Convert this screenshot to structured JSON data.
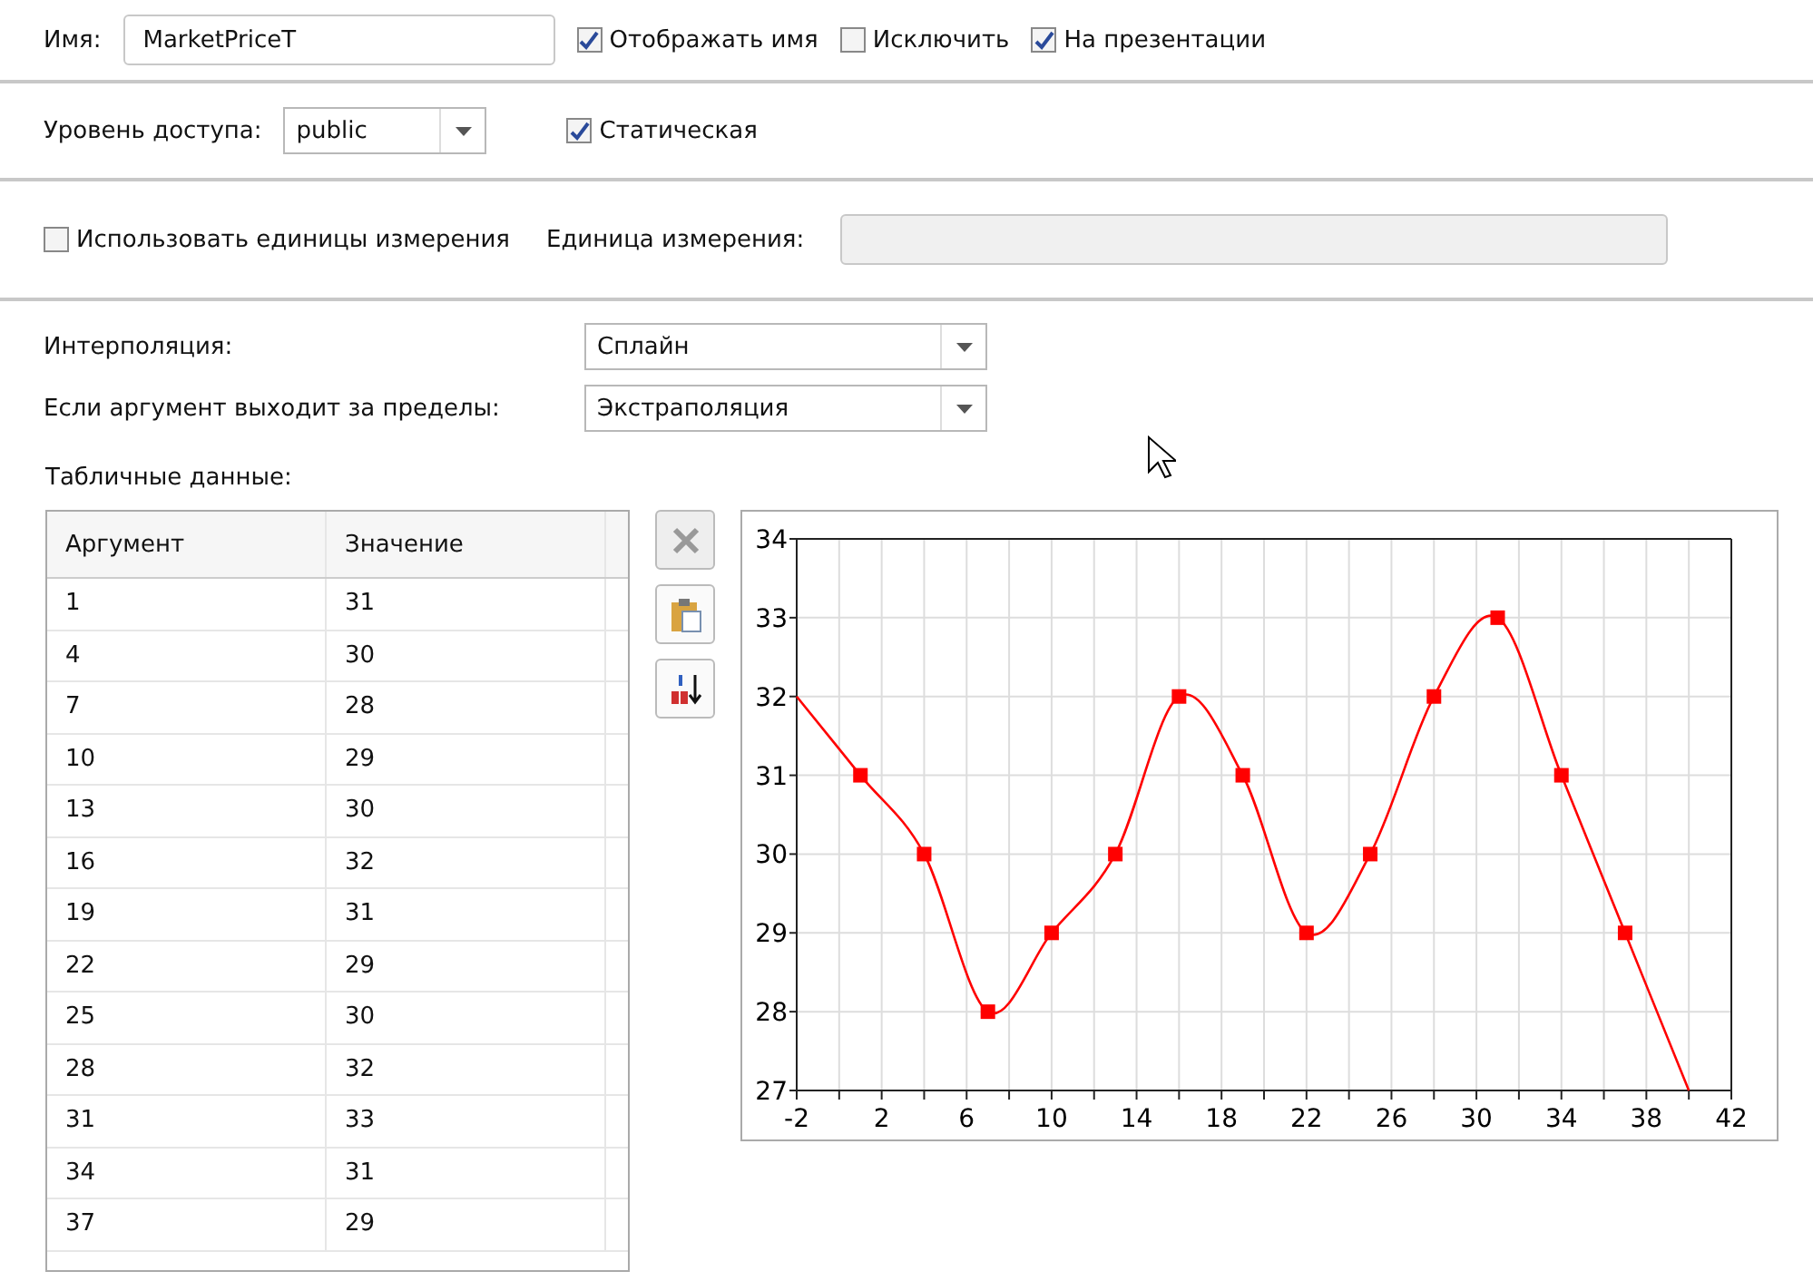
{
  "name_row": {
    "label": "Имя:",
    "value": "MarketPriceT",
    "checkboxes": [
      {
        "label": "Отображать имя",
        "checked": true
      },
      {
        "label": "Исключить",
        "checked": false
      },
      {
        "label": "На презентации",
        "checked": true
      }
    ]
  },
  "access_row": {
    "label": "Уровень доступа:",
    "value": "public",
    "checkbox": {
      "label": "Статическая",
      "checked": true
    }
  },
  "units_row": {
    "checkbox": {
      "label": "Использовать единицы измерения",
      "checked": false
    },
    "unit_label": "Единица измерения:",
    "unit_disabled": true
  },
  "interpolation": {
    "label": "Интерполяция:",
    "value": "Сплайн"
  },
  "out_of_range": {
    "label": "Если аргумент выходит за пределы:",
    "value": "Экстраполяция"
  },
  "table_label": "Табличные данные:",
  "table": {
    "columns": [
      "Аргумент",
      "Значение"
    ],
    "rows": [
      [
        "1",
        "31"
      ],
      [
        "4",
        "30"
      ],
      [
        "7",
        "28"
      ],
      [
        "10",
        "29"
      ],
      [
        "13",
        "30"
      ],
      [
        "16",
        "32"
      ],
      [
        "19",
        "31"
      ],
      [
        "22",
        "29"
      ],
      [
        "25",
        "30"
      ],
      [
        "28",
        "32"
      ],
      [
        "31",
        "33"
      ],
      [
        "34",
        "31"
      ],
      [
        "37",
        "29"
      ]
    ]
  },
  "chart_data": {
    "type": "line",
    "grid": true,
    "x": [
      -2,
      1,
      4,
      7,
      10,
      13,
      16,
      19,
      22,
      25,
      28,
      31,
      34,
      37,
      40
    ],
    "series": [
      {
        "color": "#ff0000",
        "marker": "square",
        "values": [
          32,
          31,
          30,
          28,
          29,
          30,
          32,
          31,
          29,
          30,
          32,
          33,
          31,
          29,
          27
        ]
      }
    ],
    "xlim": [
      -2,
      42
    ],
    "ylim": [
      27,
      34
    ],
    "xticks": [
      -2,
      2,
      6,
      10,
      14,
      18,
      22,
      26,
      30,
      34,
      38,
      42
    ],
    "yticks": [
      27,
      28,
      29,
      30,
      31,
      32,
      33,
      34
    ]
  }
}
